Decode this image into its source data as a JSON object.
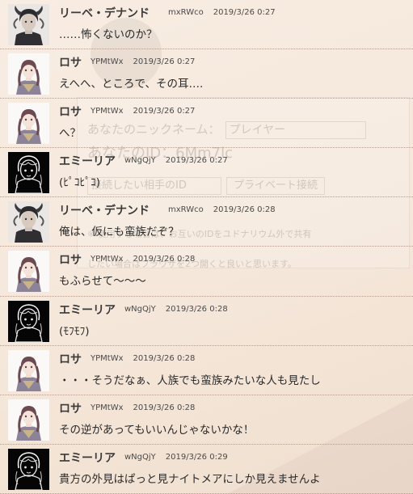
{
  "background": {
    "nickname_label": "あなたのニックネーム：",
    "nickname_value": "プレイヤー",
    "id_label": "あなたのID：6Mm7lc",
    "partner_placeholder": "接続したい相手のID",
    "private_button": "プライベート接続",
    "note1": "※ 使用する場合は、お互いのIDをユドナリウム外で共有",
    "note2": "したい場合はブラウザを2つ開くと良いと思います。"
  },
  "messages": [
    {
      "name": "リーベ・デナンド",
      "uid": "mxRWco",
      "time": "2019/3/26 0:27",
      "text": "……怖くないのか？",
      "avatar": "liebe"
    },
    {
      "name": "ロサ",
      "uid": "YPMtWx",
      "time": "2019/3/26 0:27",
      "text": "えへへ、ところで、その耳….",
      "avatar": "rosa"
    },
    {
      "name": "ロサ",
      "uid": "YPMtWx",
      "time": "2019/3/26 0:27",
      "text": "へ？",
      "avatar": "rosa"
    },
    {
      "name": "エミーリア",
      "uid": "wNgQjY",
      "time": "2019/3/26 0:27",
      "text": "(ﾋﾟｺﾋﾟｺ)",
      "avatar": "emilia"
    },
    {
      "name": "リーベ・デナンド",
      "uid": "mxRWco",
      "time": "2019/3/26 0:28",
      "text": "俺は、仮にも蛮族だぞ？",
      "avatar": "liebe"
    },
    {
      "name": "ロサ",
      "uid": "YPMtWx",
      "time": "2019/3/26 0:28",
      "text": "もふらせて〜〜〜",
      "avatar": "rosa"
    },
    {
      "name": "エミーリア",
      "uid": "wNgQjY",
      "time": "2019/3/26 0:28",
      "text": "(ﾓﾌﾓﾌ)",
      "avatar": "emilia"
    },
    {
      "name": "ロサ",
      "uid": "YPMtWx",
      "time": "2019/3/26 0:28",
      "text": "・・・そうだなぁ、人族でも蛮族みたいな人も見たし",
      "avatar": "rosa"
    },
    {
      "name": "ロサ",
      "uid": "YPMtWx",
      "time": "2019/3/26 0:28",
      "text": "その逆があってもいいんじゃないかな！",
      "avatar": "rosa"
    },
    {
      "name": "エミーリア",
      "uid": "wNgQjY",
      "time": "2019/3/26 0:29",
      "text": "貴方の外見はぱっと見ナイトメアにしか見えませんよ",
      "avatar": "emilia"
    }
  ]
}
